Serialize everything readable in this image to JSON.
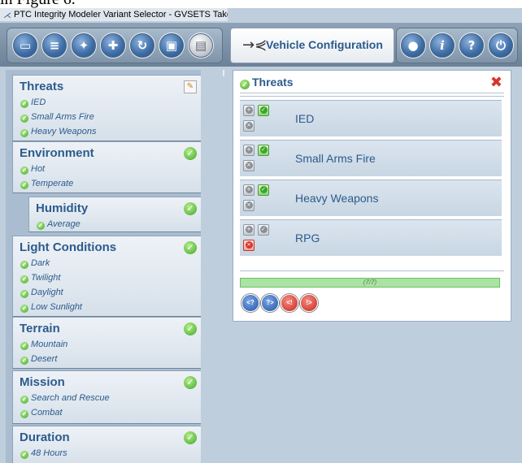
{
  "doc_fragment": "in Figure 6.",
  "window": {
    "title": "PTC Integrity Modeler Variant Selector - GVSETS Take",
    "app_icon": "connector-icon"
  },
  "toolbar": {
    "left_buttons": [
      "open-folder-icon",
      "document-icon",
      "magic-wand-icon",
      "expand-icon",
      "refresh-icon",
      "package-icon",
      "file-lock-icon"
    ],
    "center_title": "Vehicle Configuration",
    "center_icon": "connector-icon",
    "right_buttons": [
      "chat-icon",
      "info-icon",
      "help-icon",
      "power-icon"
    ]
  },
  "sections": [
    {
      "title": "Threats",
      "status": "edit",
      "items": [
        "IED",
        "Small Arms Fire",
        "Heavy Weapons"
      ]
    },
    {
      "title": "Environment",
      "status": "check",
      "items": [
        "Hot",
        "Temperate"
      ]
    },
    {
      "title": "Humidity",
      "status": "check",
      "items": [
        "Average"
      ],
      "indent": true
    },
    {
      "title": "Light Conditions",
      "status": "check",
      "items": [
        "Dark",
        "Twilight",
        "Daylight",
        "Low Sunlight"
      ]
    },
    {
      "title": "Terrain",
      "status": "check",
      "items": [
        "Mountain",
        "Desert"
      ]
    },
    {
      "title": "Mission",
      "status": "check",
      "items": [
        "Search and Rescue",
        "Combat"
      ]
    },
    {
      "title": "Duration",
      "status": "check",
      "items": [
        "48 Hours"
      ]
    }
  ],
  "threats_panel": {
    "title": "Threats",
    "rows": [
      {
        "label": "IED",
        "state": "selected"
      },
      {
        "label": "Small Arms Fire",
        "state": "selected"
      },
      {
        "label": "Heavy Weapons",
        "state": "selected"
      },
      {
        "label": "RPG",
        "state": "excluded"
      }
    ],
    "progress_text": "(7/7)",
    "progress_fraction": 1.0,
    "nav_buttons": [
      "<?",
      "?>",
      "<!",
      "!>"
    ]
  },
  "colors": {
    "accent": "#2c5b8c",
    "check_green": "#3da52a",
    "close_red": "#d9342b",
    "window_bg": "#bfcedc"
  }
}
